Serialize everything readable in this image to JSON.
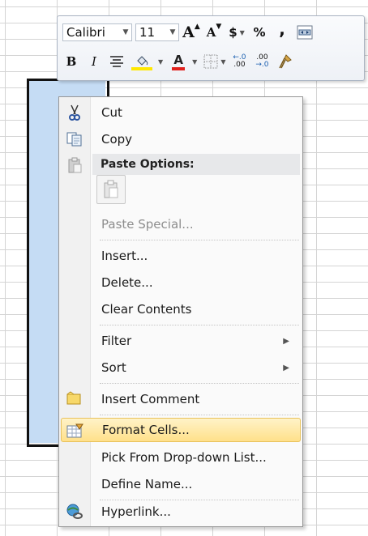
{
  "toolbar": {
    "font_name": "Calibri",
    "font_size": "11",
    "grow_font": "A",
    "shrink_font": "A",
    "currency": "$",
    "percent": "%",
    "comma": ",",
    "bold": "B",
    "italic": "I",
    "font_color": "A",
    "increase_decimal": ".00",
    "decrease_decimal": ".00"
  },
  "menu": {
    "items": [
      {
        "label": "Cut",
        "icon": "scissors-icon"
      },
      {
        "label": "Copy",
        "icon": "copy-icon"
      },
      {
        "label": "Paste Options:",
        "icon": "paste-icon"
      },
      {
        "label": "Paste Special...",
        "disabled": true
      },
      {
        "label": "Insert..."
      },
      {
        "label": "Delete..."
      },
      {
        "label": "Clear Contents"
      },
      {
        "label": "Filter"
      },
      {
        "label": "Sort"
      },
      {
        "label": "Insert Comment",
        "icon": "comment-icon"
      },
      {
        "label": "Format Cells...",
        "icon": "format-cells-icon"
      },
      {
        "label": "Pick From Drop-down List..."
      },
      {
        "label": "Define Name..."
      },
      {
        "label": "Hyperlink...",
        "icon": "hyperlink-icon"
      }
    ]
  },
  "colors": {
    "selection_fill": "#c5dcf4",
    "hover_highlight": "#ffe08a",
    "font_color_bar": "#e0201c",
    "highlight_bar": "#ffe800"
  }
}
